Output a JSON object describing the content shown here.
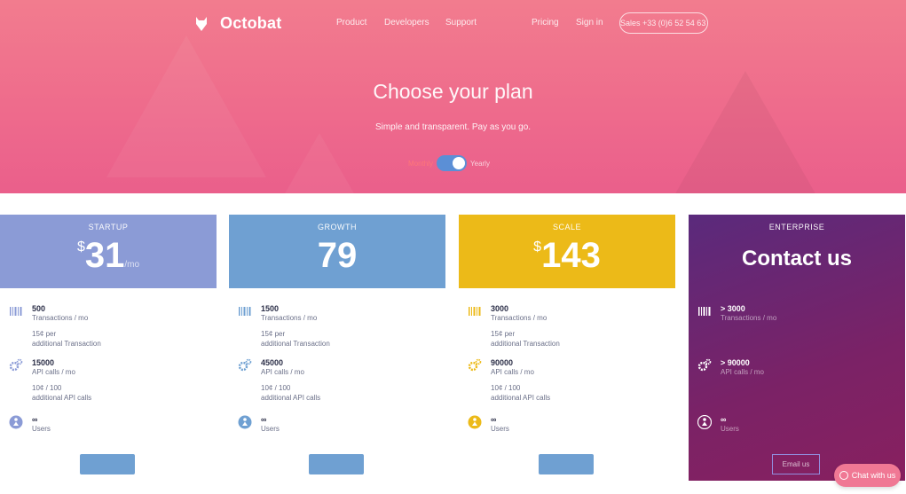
{
  "brand": {
    "name": "Octobat",
    "icon": "fox-logo-icon"
  },
  "nav": {
    "links": [
      "Product",
      "Developers",
      "Support",
      "Pricing",
      "Sign in"
    ],
    "cta": "Sales +33 (0)6 52 54 63 76"
  },
  "hero": {
    "title": "Choose your plan",
    "subtitle": "Simple and transparent. Pay as you go.",
    "toggle": {
      "left_label": "Monthly",
      "right_label": "Yearly",
      "selected": "Yearly"
    }
  },
  "colors": {
    "hero": "#ee6a8c",
    "startup": "#8b9bd6",
    "growth": "#6fa0d2",
    "scale": "#ecba18",
    "enterprise": "#6a2473",
    "button": "#6fa0d2",
    "chat": "#f07894"
  },
  "plans": [
    {
      "name": "STARTUP",
      "currency": "$",
      "price": "31",
      "per": "/mo",
      "transactions": {
        "value": "500",
        "label": "Transactions / mo",
        "extra1": "15¢ per",
        "extra2": "additional Transaction"
      },
      "api": {
        "value": "15000",
        "label": "API calls / mo",
        "extra1": "10¢ / 100",
        "extra2": "additional API calls"
      },
      "users": {
        "value": "∞",
        "label": "Users"
      }
    },
    {
      "name": "GROWTH",
      "currency": "",
      "price": "79",
      "per": "",
      "transactions": {
        "value": "1500",
        "label": "Transactions / mo",
        "extra1": "15¢ per",
        "extra2": "additional Transaction"
      },
      "api": {
        "value": "45000",
        "label": "API calls / mo",
        "extra1": "10¢ / 100",
        "extra2": "additional API calls"
      },
      "users": {
        "value": "∞",
        "label": "Users"
      }
    },
    {
      "name": "SCALE",
      "currency": "$",
      "price": "143",
      "per": "",
      "transactions": {
        "value": "3000",
        "label": "Transactions / mo",
        "extra1": "15¢ per",
        "extra2": "additional Transaction"
      },
      "api": {
        "value": "90000",
        "label": "API calls / mo",
        "extra1": "10¢ / 100",
        "extra2": "additional API calls"
      },
      "users": {
        "value": "∞",
        "label": "Users"
      }
    },
    {
      "name": "ENTERPRISE",
      "contact": "Contact us",
      "transactions": {
        "value": "> 3000",
        "label": "Transactions / mo"
      },
      "api": {
        "value": "> 90000",
        "label": "API calls / mo"
      },
      "users": {
        "value": "∞",
        "label": "Users"
      },
      "button": "Email us"
    }
  ],
  "chat": {
    "label": "Chat with us"
  }
}
